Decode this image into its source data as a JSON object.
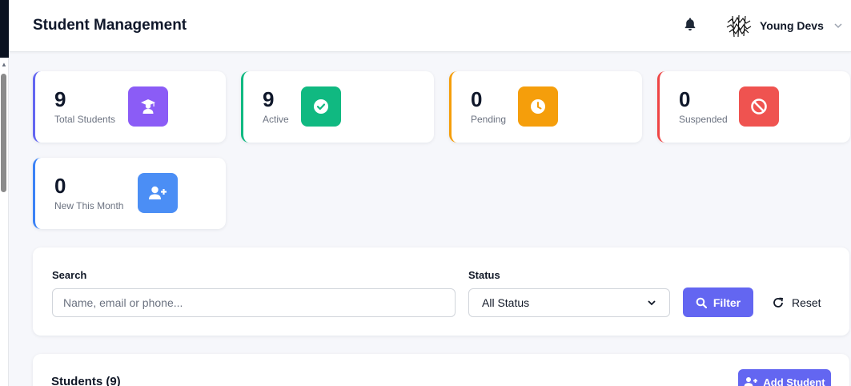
{
  "header": {
    "title": "Student Management",
    "user_name": "Young Devs",
    "bell_icon": "bell-icon",
    "chevron_icon": "chevron-down-icon"
  },
  "stats": [
    {
      "value": "9",
      "label": "Total Students",
      "icon": "graduate-icon",
      "accent": "#6366f1",
      "icon_bg": "#8b5cf6"
    },
    {
      "value": "9",
      "label": "Active",
      "icon": "check-circle-icon",
      "accent": "#10b981",
      "icon_bg": "#10b981"
    },
    {
      "value": "0",
      "label": "Pending",
      "icon": "clock-icon",
      "accent": "#f59e0b",
      "icon_bg": "#f59e0b"
    },
    {
      "value": "0",
      "label": "Suspended",
      "icon": "ban-icon",
      "accent": "#ef4444",
      "icon_bg": "#ef4444"
    },
    {
      "value": "0",
      "label": "New This Month",
      "icon": "user-plus-icon",
      "accent": "#3b82f6",
      "icon_bg": "#3b82f6"
    }
  ],
  "filters": {
    "search_label": "Search",
    "search_placeholder": "Name, email or phone...",
    "search_value": "",
    "status_label": "Status",
    "status_value": "All Status",
    "filter_label": "Filter",
    "reset_label": "Reset"
  },
  "students": {
    "title": "Students (9)",
    "add_label": "Add Student"
  }
}
